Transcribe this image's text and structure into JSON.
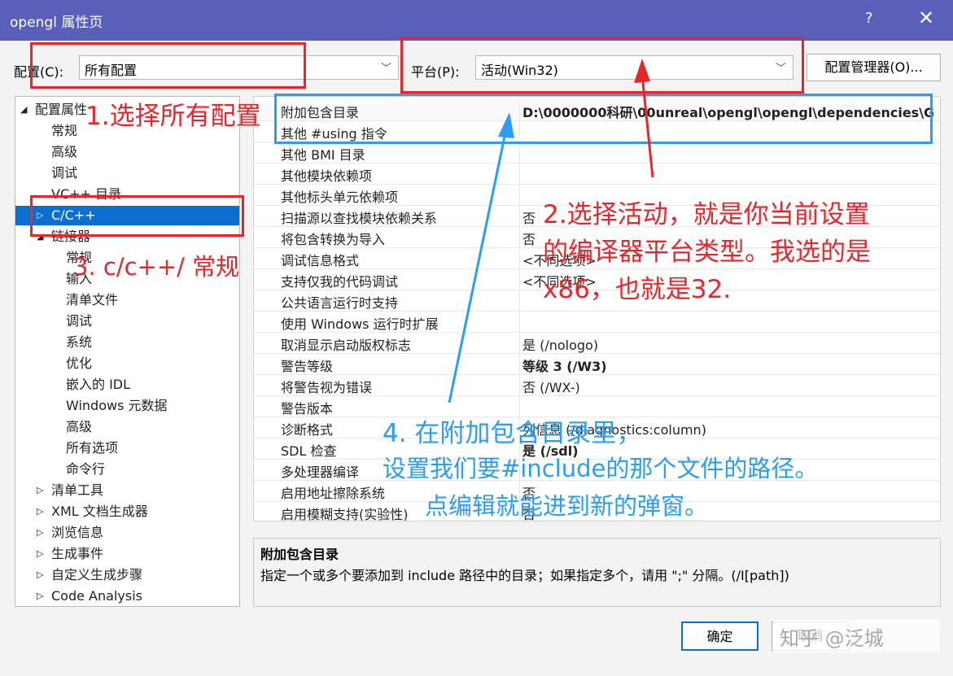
{
  "window": {
    "title": "opengl 属性页",
    "help": "?",
    "close": "✕"
  },
  "toolbar": {
    "config_label": "配置(C):",
    "config_value": "所有配置",
    "platform_label": "平台(P):",
    "platform_value": "活动(Win32)",
    "manager_button": "配置管理器(O)..."
  },
  "tree": {
    "items": [
      {
        "label": "配置属性"
      },
      {
        "label": "常规"
      },
      {
        "label": "高级"
      },
      {
        "label": "调试"
      },
      {
        "label": "VC++ 目录"
      },
      {
        "label": "C/C++"
      },
      {
        "label": "链接器"
      },
      {
        "label": "常规"
      },
      {
        "label": "输入"
      },
      {
        "label": "清单文件"
      },
      {
        "label": "调试"
      },
      {
        "label": "系统"
      },
      {
        "label": "优化"
      },
      {
        "label": "嵌入的 IDL"
      },
      {
        "label": "Windows 元数据"
      },
      {
        "label": "高级"
      },
      {
        "label": "所有选项"
      },
      {
        "label": "命令行"
      },
      {
        "label": "清单工具"
      },
      {
        "label": "XML 文档生成器"
      },
      {
        "label": "浏览信息"
      },
      {
        "label": "生成事件"
      },
      {
        "label": "自定义生成步骤"
      },
      {
        "label": "Code Analysis"
      }
    ]
  },
  "grid": {
    "rows": [
      {
        "name": "附加包含目录",
        "value": "D:\\0000000科研\\00unreal\\opengl\\opengl\\dependencies\\G"
      },
      {
        "name": "其他 #using 指令",
        "value": ""
      },
      {
        "name": "其他 BMI 目录",
        "value": ""
      },
      {
        "name": "其他模块依赖项",
        "value": ""
      },
      {
        "name": "其他标头单元依赖项",
        "value": ""
      },
      {
        "name": "扫描源以查找模块依赖关系",
        "value": "否"
      },
      {
        "name": "将包含转换为导入",
        "value": "否"
      },
      {
        "name": "调试信息格式",
        "value": "<不同选项>"
      },
      {
        "name": "支持仅我的代码调试",
        "value": "<不同选项>"
      },
      {
        "name": "公共语言运行时支持",
        "value": ""
      },
      {
        "name": "使用 Windows 运行时扩展",
        "value": ""
      },
      {
        "name": "取消显示启动版权标志",
        "value": "是 (/nologo)"
      },
      {
        "name": "警告等级",
        "value": "等级 3 (/W3)"
      },
      {
        "name": "将警告视为错误",
        "value": "否 (/WX-)"
      },
      {
        "name": "警告版本",
        "value": ""
      },
      {
        "name": "诊断格式",
        "value": "列信息 (/diagnostics:column)"
      },
      {
        "name": "SDL 检查",
        "value": "是 (/sdl)"
      },
      {
        "name": "多处理器编译",
        "value": ""
      },
      {
        "name": "启用地址擦除系统",
        "value": "否"
      },
      {
        "name": "启用模糊支持(实验性)",
        "value": "否"
      }
    ]
  },
  "description": {
    "title": "附加包含目录",
    "text": "指定一个或多个要添加到 include 路径中的目录；如果指定多个，请用 \";\" 分隔。(/I[path])"
  },
  "footer": {
    "ok": "确定",
    "cancel": "取消"
  },
  "watermark": "知乎 @泛城",
  "annotations": {
    "a1": "1.选择所有配置",
    "a2_l1": "2.选择活动，就是你当前设置",
    "a2_l2": "的编译器平台类型。我选的是",
    "a2_l3": "x86，也就是32.",
    "a3": "3. c/c++/ 常规",
    "a4_l1": "4. 在附加包含目录里，",
    "a4_l2": "设置我们要#include的那个文件的路径。",
    "a4_l3": "点编辑就能进到新的弹窗。"
  },
  "colors": {
    "titlebar": "#5a5fb9",
    "selection": "#0a6fd1",
    "annotation_red": "#e8262a",
    "annotation_blue": "#2a9df4"
  }
}
